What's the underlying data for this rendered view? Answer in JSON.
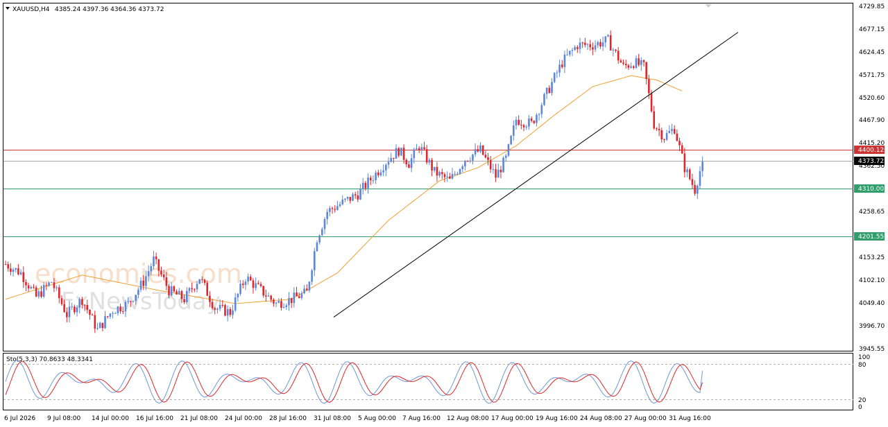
{
  "header": {
    "symbol": "XAUUSD,H4",
    "ohlc": "4385.24 4397.36 4364.36 4373.72"
  },
  "watermark": {
    "line1": "economies.com",
    "line2": "FxNewsToday"
  },
  "colors": {
    "bull": "#5b86d9",
    "bear": "#e0262c",
    "ma": "#f0a030",
    "trendline": "#000000",
    "resistance": "#cc3333",
    "support": "#2f9e6a",
    "current": "#a8a8a8",
    "stoch_main": "#6f96d8",
    "stoch_signal": "#e0262c"
  },
  "chart_data": [
    {
      "type": "candlestick",
      "title": "XAUUSD,H4",
      "ylim": [
        3945.55,
        4729.85
      ],
      "y_ticks": [
        "4729.85",
        "4677.15",
        "4624.45",
        "4571.75",
        "4520.60",
        "4467.90",
        "4415.20",
        "4362.50",
        "4310.00",
        "4258.65",
        "4205.95",
        "4153.25",
        "4102.10",
        "4049.40",
        "3996.70",
        "3945.55"
      ],
      "x_ticks": [
        "6 Jul 2026",
        "9 Jul 08:00",
        "14 Jul 00:00",
        "16 Jul 16:00",
        "21 Jul 08:00",
        "24 Jul 00:00",
        "28 Jul 16:00",
        "31 Jul 08:00",
        "5 Aug 00:00",
        "7 Aug 16:00",
        "12 Aug 08:00",
        "17 Aug 00:00",
        "19 Aug 16:00",
        "24 Aug 08:00",
        "27 Aug 00:00",
        "31 Aug 16:00"
      ],
      "levels": [
        {
          "label": "4400.12",
          "value": 4400.12,
          "role": "resistance"
        },
        {
          "label": "4373.72",
          "value": 4373.72,
          "role": "current"
        },
        {
          "label": "4310.00",
          "value": 4310.0,
          "role": "support"
        },
        {
          "label": "4201.55",
          "value": 4201.55,
          "role": "support"
        }
      ],
      "price_anchors": [
        [
          0,
          4140
        ],
        [
          6,
          4120
        ],
        [
          12,
          4065
        ],
        [
          18,
          4100
        ],
        [
          24,
          4025
        ],
        [
          30,
          4060
        ],
        [
          36,
          3990
        ],
        [
          42,
          4035
        ],
        [
          48,
          4050
        ],
        [
          54,
          4100
        ],
        [
          58,
          4150
        ],
        [
          64,
          4080
        ],
        [
          70,
          4060
        ],
        [
          76,
          4110
        ],
        [
          82,
          4040
        ],
        [
          88,
          4030
        ],
        [
          94,
          4110
        ],
        [
          100,
          4080
        ],
        [
          106,
          4050
        ],
        [
          112,
          4060
        ],
        [
          118,
          4075
        ],
        [
          122,
          4200
        ],
        [
          126,
          4260
        ],
        [
          132,
          4280
        ],
        [
          138,
          4300
        ],
        [
          144,
          4340
        ],
        [
          150,
          4380
        ],
        [
          154,
          4400
        ],
        [
          158,
          4370
        ],
        [
          162,
          4410
        ],
        [
          168,
          4350
        ],
        [
          174,
          4330
        ],
        [
          180,
          4380
        ],
        [
          186,
          4400
        ],
        [
          192,
          4340
        ],
        [
          196,
          4380
        ],
        [
          200,
          4470
        ],
        [
          206,
          4460
        ],
        [
          212,
          4530
        ],
        [
          218,
          4600
        ],
        [
          224,
          4640
        ],
        [
          230,
          4640
        ],
        [
          236,
          4650
        ],
        [
          242,
          4590
        ],
        [
          246,
          4600
        ],
        [
          250,
          4590
        ],
        [
          254,
          4460
        ],
        [
          258,
          4430
        ],
        [
          262,
          4450
        ],
        [
          266,
          4360
        ],
        [
          270,
          4310
        ],
        [
          273,
          4374
        ]
      ],
      "ma_anchors": [
        [
          0,
          4060
        ],
        [
          30,
          4115
        ],
        [
          60,
          4080
        ],
        [
          90,
          4050
        ],
        [
          112,
          4060
        ],
        [
          130,
          4120
        ],
        [
          150,
          4240
        ],
        [
          170,
          4330
        ],
        [
          185,
          4360
        ],
        [
          200,
          4410
        ],
        [
          215,
          4480
        ],
        [
          230,
          4545
        ],
        [
          245,
          4570
        ],
        [
          255,
          4560
        ],
        [
          265,
          4535
        ]
      ],
      "trendline": [
        [
          4019,
          4030
        ],
        [
          4669,
          4680
        ]
      ],
      "ma_end": 4540
    },
    {
      "type": "line",
      "title": "Sto(5,3,3) 70.8633 48.3341",
      "ylim": [
        0,
        100
      ],
      "y_ticks": [
        "100",
        "80",
        "20",
        "0"
      ],
      "levels": [
        80,
        20
      ],
      "series": [
        {
          "name": "main",
          "last": 70.8633
        },
        {
          "name": "signal",
          "last": 48.3341
        }
      ]
    }
  ]
}
